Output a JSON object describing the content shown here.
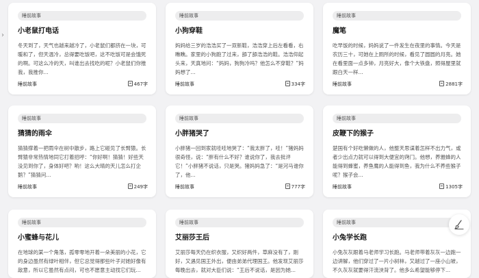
{
  "cards": [
    {
      "category": "睡前故事",
      "title": "小老鼠打电话",
      "excerpt": "冬天到了，天气也越来越冷了，小老鼠们都挤在一块，可暖和了，但天温冷，总得要吃饭吧，这不吃饭可是会饿死的啊。可这么冷的天，叫谁出去找吃的呢？小老鼠们你推我，我推你...",
      "word_count": "467字"
    },
    {
      "category": "睡前故事",
      "title": "小狗穿鞋",
      "excerpt": "妈妈给三岁的浩浩买了一双新鞋，浩浩穿上后左看看，右瞧瞧。家里的小狗跑了过来，舔了舔浩浩的鞋。浩浩仰起头来，天真地问：“妈妈，狗狗冷吗？他怎么不穿鞋？”妈妈想了...",
      "word_count": "334字"
    },
    {
      "category": "睡前故事",
      "title": "魔笔",
      "excerpt": "吃早饭的时候，妈妈说了一件发生在夜里的事情。今天是农历三十，可她在上厕所的时候，看见了圆圆的月亮。她在看里面一点多钟，月亮好大，像个大铁盘，照得屋里就跟白天一样...",
      "word_count": "2881字"
    },
    {
      "category": "睡前故事",
      "title": "猜猜的雨伞",
      "excerpt": "猜猜撑着一把雨伞在树中散步，路上它碰见了长臂猿。长臂猿非常热情地同它打着招呼：“你好啊！猜猜！好些天没见到你了，身体好吧？哟！这么大晴的天儿怎么打企鹅？”猜猜问...",
      "word_count": "249字"
    },
    {
      "category": "睡前故事",
      "title": "小胖猪哭了",
      "excerpt": "小胖猪一回到家就哇哇地哭了：“我太胖了，哇！”猪妈妈很奇怪，说：“胖有什么不好？谁说你了，我去批评它！”小胖猪不说话，只是哭。猪妈妈急了：“是河马谁你了，他...",
      "word_count": "777字"
    },
    {
      "category": "睡前故事",
      "title": "皮鞭下的猴子",
      "excerpt": "楚国有个好吃懒做的人，他整天思谋着怎样不出力气，或者少出点力就可以得到大便宜的窍门。他想，养雅蜂的人能得到蜂蜜，养鱼鹰的人能得到鱼，我为什么不养些猴子呢？猴子会...",
      "word_count": "1305字"
    },
    {
      "category": "睡前故事",
      "title": "小蜜蜂与花儿",
      "excerpt": "在地球的某一个角落，孤零零地开着一朵美丽的小花，它的身边虽然有绿叶相伴，但它总觉得那些叶子对她好像有敌意，所以它虽然有点闷，可也不愿意主动找它们玩...",
      "word_count": ""
    },
    {
      "category": "睡前故事",
      "title": "艾丽莎王后",
      "excerpt": "艾丽莎每天仍在织衣服，又织好两件，草麻没有了，刚好，又遇见国王外出，便由弟弟代理国王。他发现艾丽莎每晚出去，就对大臣们说：“王后不说话，是因为她...",
      "word_count": ""
    },
    {
      "category": "睡前故事",
      "title": "小兔学长跑",
      "excerpt": "小兔灰灰跟着马老师学习长跑。马老师带着灰灰一边跑一边讲解，他们穿过了一片小树林，又越过了一座小山坡，不久灰灰就要得汗流浃背了。他多么希望能够停下...",
      "word_count": ""
    }
  ]
}
